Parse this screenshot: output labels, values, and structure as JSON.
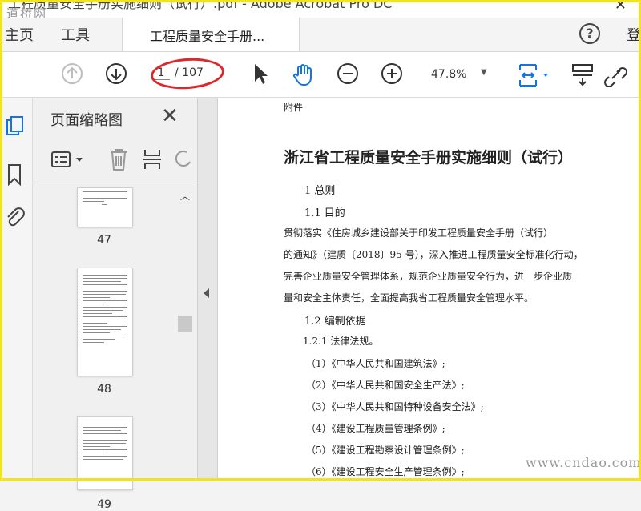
{
  "window": {
    "title": "工程质量安全手册实施细则（试行）.pdf - Adobe Acrobat Pro DC",
    "watermark_top": "道桥网"
  },
  "menu": {
    "home": "主页",
    "tools": "工具",
    "login": "登"
  },
  "tab": {
    "title": "工程质量安全手册...",
    "close": "✕"
  },
  "toolbar": {
    "current_page": "1",
    "total_pages": "/ 107",
    "zoom": "47.8%"
  },
  "thumbnails": {
    "panel_title": "页面缩略图",
    "pages": [
      {
        "number": "47"
      },
      {
        "number": "48"
      },
      {
        "number": "49"
      }
    ]
  },
  "document": {
    "attachment": "附件",
    "title": "浙江省工程质量安全手册实施细则（试行）",
    "h1": "1  总则",
    "h1_1": "1.1  目的",
    "body": [
      "贯彻落实《住房城乡建设部关于印发工程质量安全手册（试行）",
      "的通知》（建质〔2018〕95 号），深入推进工程质量安全标准化行动，",
      "完善企业质量安全管理体系，规范企业质量安全行为，进一步企业质",
      "量和安全主体责任，全面提高我省工程质量安全管理水平。"
    ],
    "h1_2": "1.2  编制依据",
    "h1_2_1": "1.2.1  法律法规。",
    "laws": [
      "（1）《中华人民共和国建筑法》;",
      "（2）《中华人民共和国安全生产法》;",
      "（3）《中华人民共和国特种设备安全法》;",
      "（4）《建设工程质量管理条例》;",
      "（5）《建设工程勘察设计管理条例》;",
      "（6）《建设工程安全生产管理条例》;"
    ]
  },
  "watermark_bottom": "www.cndao.com",
  "colors": {
    "accent": "#1473e6",
    "annotation": "#e0262b",
    "frame": "#f4e21b"
  }
}
